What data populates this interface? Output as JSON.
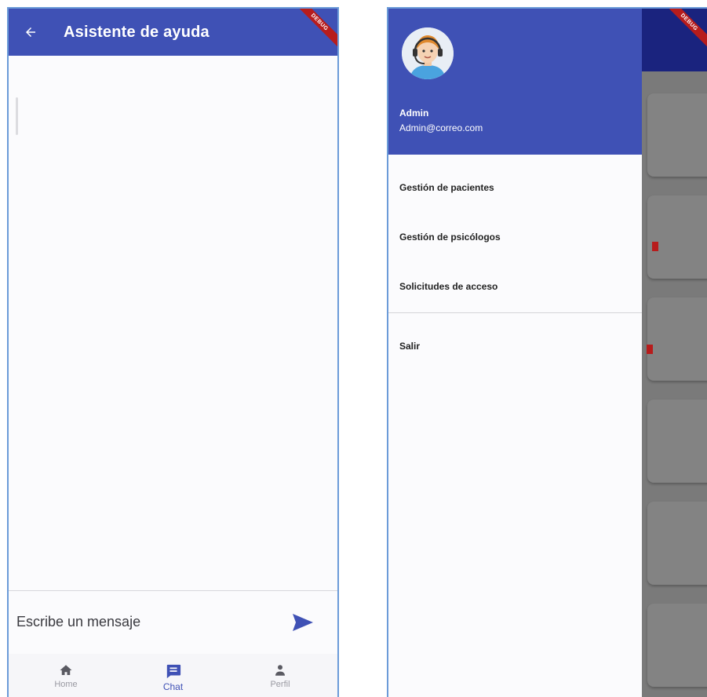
{
  "chat_screen": {
    "appbar": {
      "title": "Asistente de ayuda",
      "back_icon": "arrow-back-icon"
    },
    "debug_banner": "DEBUG",
    "composer": {
      "placeholder": "Escribe un mensaje",
      "send_icon": "send-icon"
    },
    "bottom_nav": [
      {
        "label": "Home",
        "icon": "home-icon",
        "active": false
      },
      {
        "label": "Chat",
        "icon": "chat-icon",
        "active": true
      },
      {
        "label": "Perfil",
        "icon": "person-icon",
        "active": false
      }
    ]
  },
  "drawer_screen": {
    "debug_banner": "DEBUG",
    "header": {
      "avatar_icon": "support-agent-avatar",
      "name": "Admin",
      "email": "Admin@correo.com"
    },
    "menu": [
      {
        "label": "Gestión de pacientes"
      },
      {
        "label": "Gestión de psicólogos"
      },
      {
        "label": "Solicitudes de acceso"
      }
    ],
    "exit_label": "Salir"
  },
  "colors": {
    "primary": "#3f51b5",
    "primary_dark": "#1a237e",
    "debug": "#b71c1c",
    "frame_border": "#6b9bd8"
  }
}
